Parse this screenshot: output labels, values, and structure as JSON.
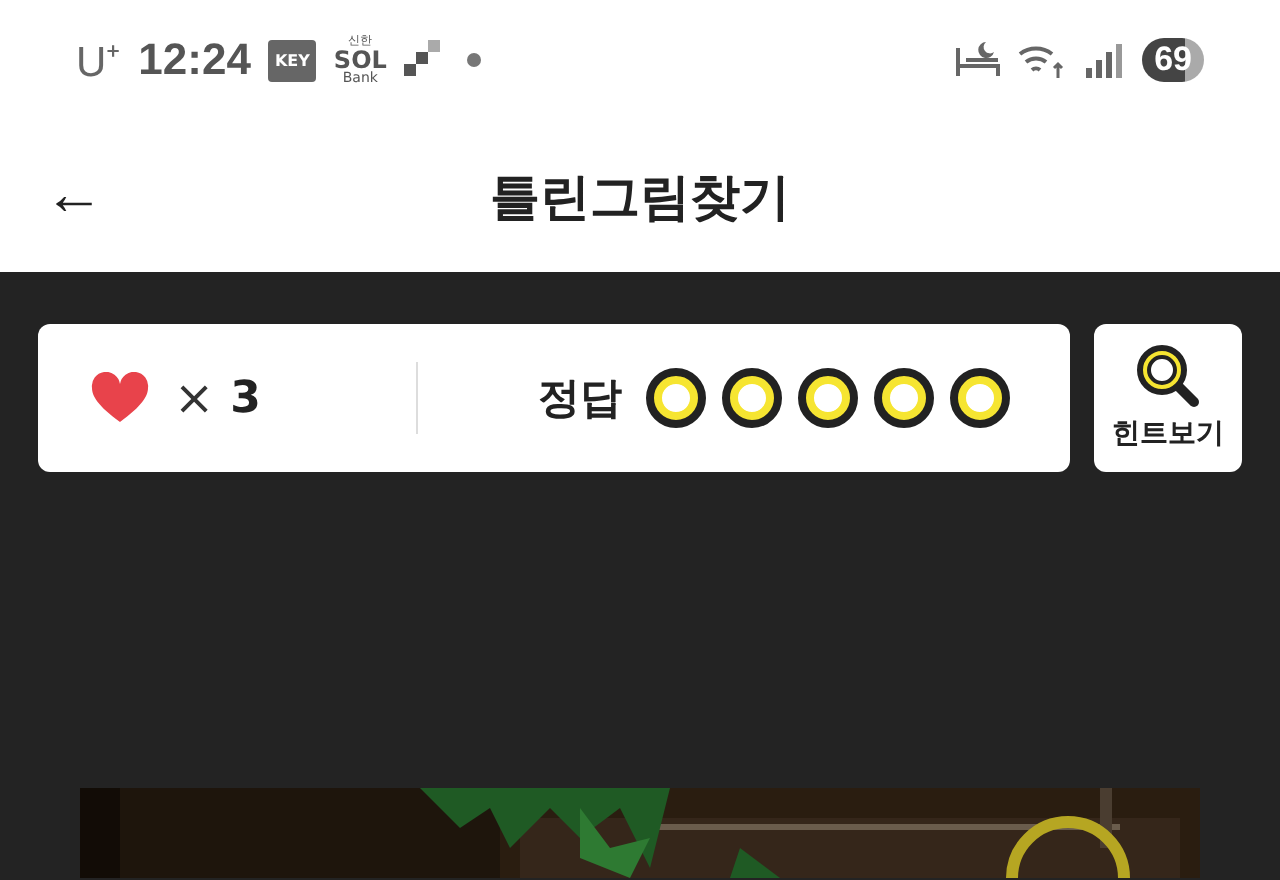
{
  "status_bar": {
    "carrier": "U⁺",
    "time": "12:24",
    "app_badges": [
      "KEY"
    ],
    "bank_logo": {
      "top": "신한",
      "main": "SOL",
      "bottom": "Bank"
    },
    "battery": "69"
  },
  "header": {
    "back": "←",
    "title": "틀린그림찾기"
  },
  "score_card": {
    "lives_sign": "×",
    "lives": "3",
    "answer_label": "정답",
    "answers": [
      {
        "found": false
      },
      {
        "found": false
      },
      {
        "found": false
      },
      {
        "found": false
      },
      {
        "found": false
      }
    ]
  },
  "hint_button": {
    "label": "힌트보기"
  }
}
